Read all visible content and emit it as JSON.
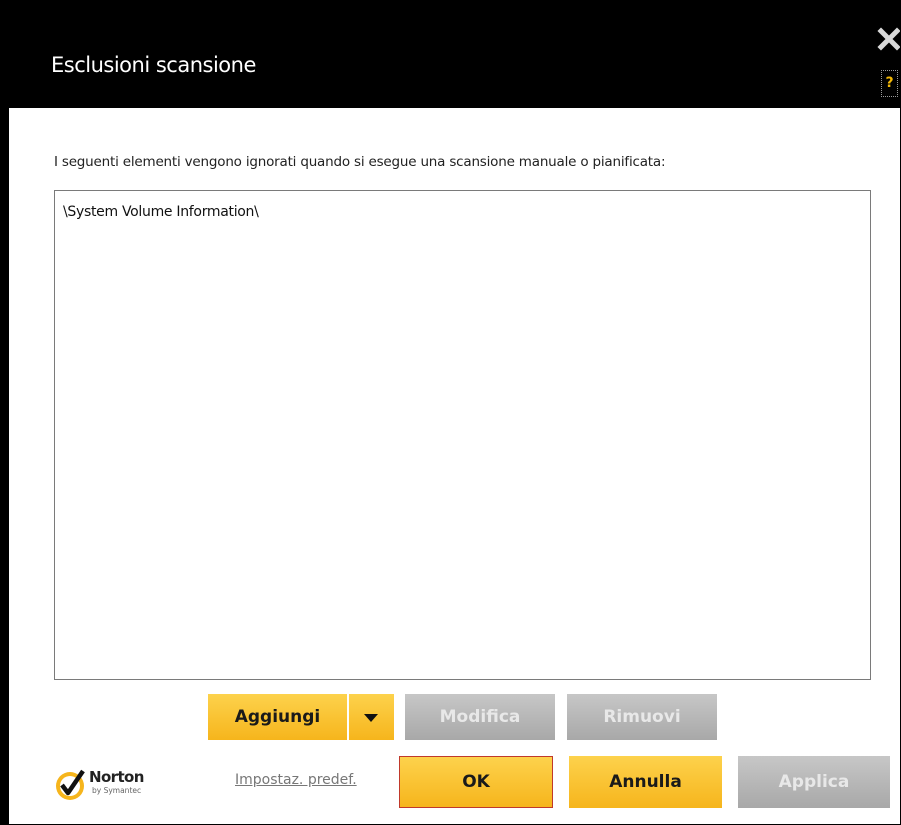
{
  "window": {
    "title": "Esclusioni scansione",
    "help_label": "?"
  },
  "description": "I seguenti elementi vengono ignorati quando si esegue una scansione manuale o pianificata:",
  "exclusions": [
    "\\System Volume Information\\"
  ],
  "actions": {
    "add_label": "Aggiungi",
    "modify_label": "Modifica",
    "remove_label": "Rimuovi"
  },
  "footer": {
    "default_settings_label": "Impostaz. predef.",
    "ok_label": "OK",
    "cancel_label": "Annulla",
    "apply_label": "Applica"
  },
  "logo": {
    "name": "Norton",
    "sub": "by Symantec"
  },
  "colors": {
    "accent_yellow": "#f9c12e",
    "disabled_gray": "#b5b5b5",
    "titlebar": "#000000",
    "ok_border": "#c0392b"
  },
  "icons": {
    "close": "close-icon",
    "help": "help-icon",
    "dropdown": "triangle-down-icon",
    "logo": "norton-checkmark-icon"
  }
}
